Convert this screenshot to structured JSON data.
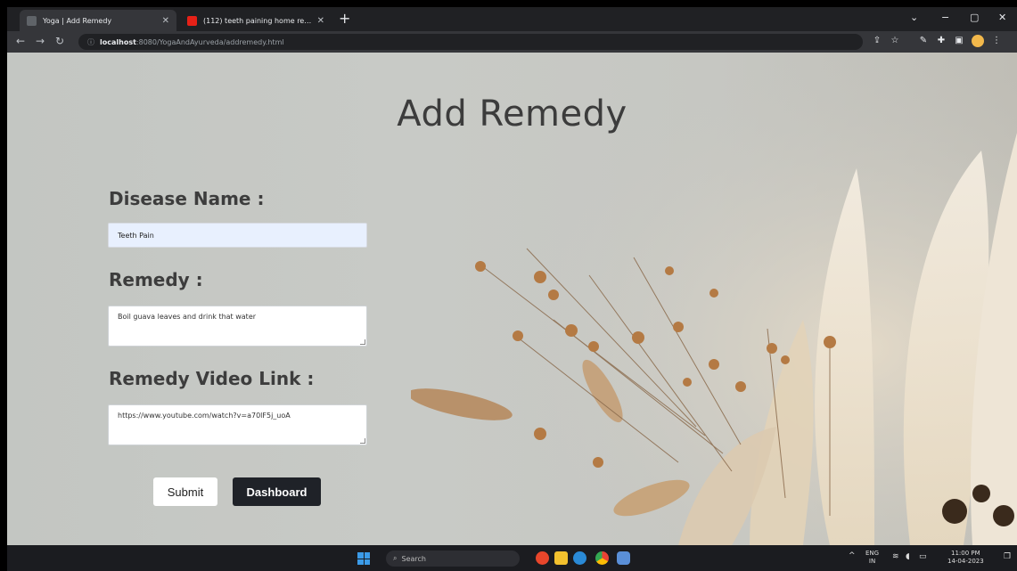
{
  "browser": {
    "tabs": [
      {
        "title": "Yoga | Add Remedy",
        "active": true,
        "favicon_color": "#5f6368"
      },
      {
        "title": "(112) teeth paining home reme...",
        "active": false,
        "favicon_color": "#e62117"
      }
    ],
    "new_tab_label": "+",
    "url_host": "localhost",
    "url_path": ":8080/YogaAndAyurveda/addremedy.html",
    "window_controls": {
      "chevron": "⌄",
      "minimize": "−",
      "maximize": "▢",
      "close": "✕"
    }
  },
  "page": {
    "title": "Add Remedy",
    "fields": {
      "disease_label": "Disease Name :",
      "disease_value": "Teeth Pain",
      "remedy_label": "Remedy :",
      "remedy_value": "Boil guava leaves and drink that water",
      "video_label": "Remedy Video Link :",
      "video_value": "https://www.youtube.com/watch?v=a70lF5j_uoA"
    },
    "buttons": {
      "submit": "Submit",
      "dashboard": "Dashboard"
    }
  },
  "taskbar": {
    "search_placeholder": "Search",
    "tray": {
      "lang_top": "ENG",
      "lang_bottom": "IN",
      "time": "11:00 PM",
      "date": "14-04-2023"
    }
  },
  "colors": {
    "accent_dark_button": "#1f2228",
    "autofill_input": "#e8f0fe",
    "title_text": "#3c3c3c"
  }
}
